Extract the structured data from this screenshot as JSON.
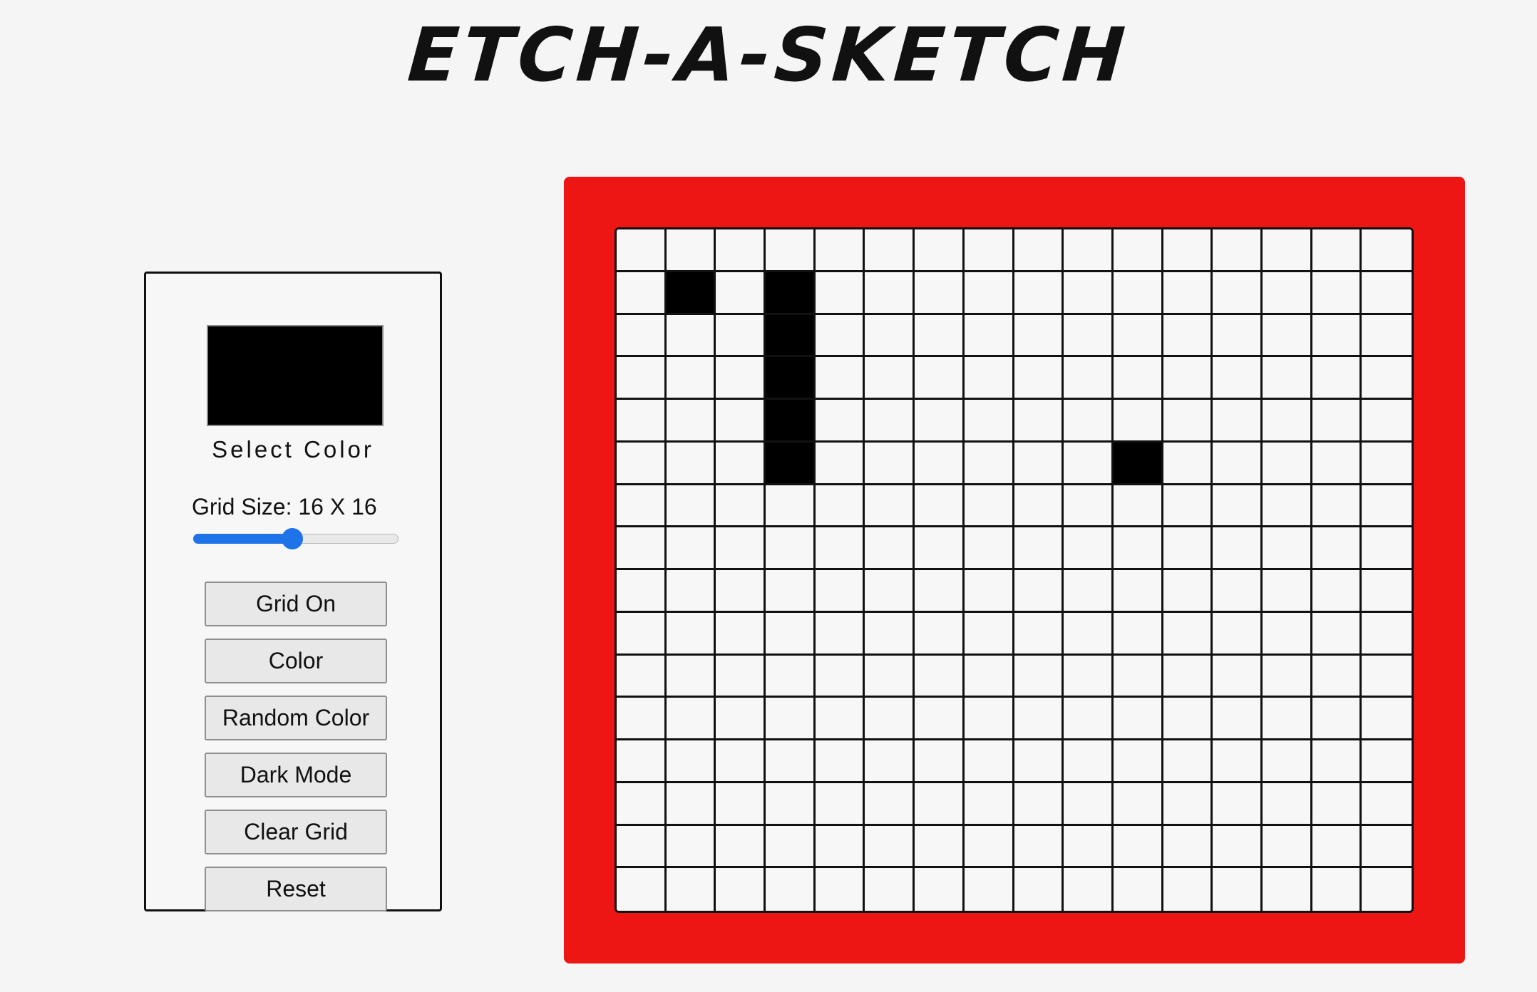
{
  "header": {
    "title": "ETCH-A-SKETCH"
  },
  "controls": {
    "swatch_color": "#000000",
    "select_color_label": "Select Color",
    "grid_size_label": "Grid Size: 16 X 16",
    "grid_size_slider": {
      "min": 1,
      "max": 32,
      "value": 16
    },
    "buttons": [
      "Grid On",
      "Color",
      "Random Color",
      "Dark Mode",
      "Clear Grid",
      "Reset"
    ]
  },
  "colors": {
    "frame": "#ee1515",
    "slider_accent": "#1f73e8",
    "cell_background": "#f6f7f6",
    "grid_lines": "#111111",
    "filled": "#000000"
  },
  "grid": {
    "columns": 16,
    "rows": 16,
    "filled_cells": [
      [
        1,
        1
      ],
      [
        1,
        3
      ],
      [
        2,
        3
      ],
      [
        3,
        3
      ],
      [
        4,
        3
      ],
      [
        5,
        3
      ],
      [
        5,
        10
      ]
    ]
  }
}
